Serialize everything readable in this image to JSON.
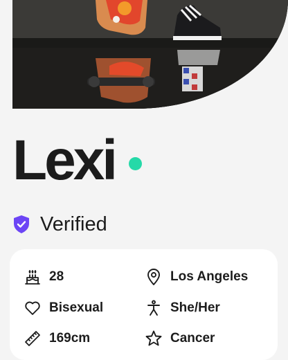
{
  "profile": {
    "name": "Lexi",
    "online_color": "#25d9a8",
    "verified_label": "Verified",
    "verified_color": "#6c45f5"
  },
  "attributes": {
    "age": "28",
    "location": "Los Angeles",
    "orientation": "Bisexual",
    "pronouns": "She/Her",
    "height": "169cm",
    "zodiac": "Cancer"
  },
  "icons": {
    "age": "birthday-cake-icon",
    "location": "map-pin-icon",
    "orientation": "heart-icon",
    "pronouns": "person-icon",
    "height": "ruler-icon",
    "zodiac": "star-icon"
  }
}
